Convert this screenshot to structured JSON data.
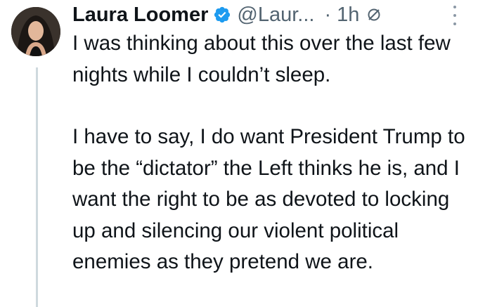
{
  "author": {
    "name": "Laura Loomer",
    "handle": "@Laur...",
    "verified_icon": "verified-badge-icon",
    "avatar_icon": "avatar"
  },
  "meta": {
    "separator": "·",
    "time": "1h",
    "stop_icon": "slashed-circle-icon",
    "more_icon": "more-options-icon"
  },
  "tweet": {
    "paragraphs": [
      "I was thinking about this over the last few nights while I couldn’t sleep.",
      "I have to say, I do want President Trump to be the “dictator” the Left thinks he is, and I want the right to be as devoted to locking up and silencing our violent political enemies as they pretend we are."
    ]
  },
  "colors": {
    "text": "#0f1419",
    "secondary": "#536471",
    "verified": "#1d9bf0",
    "thread_line": "#cfd9de"
  }
}
